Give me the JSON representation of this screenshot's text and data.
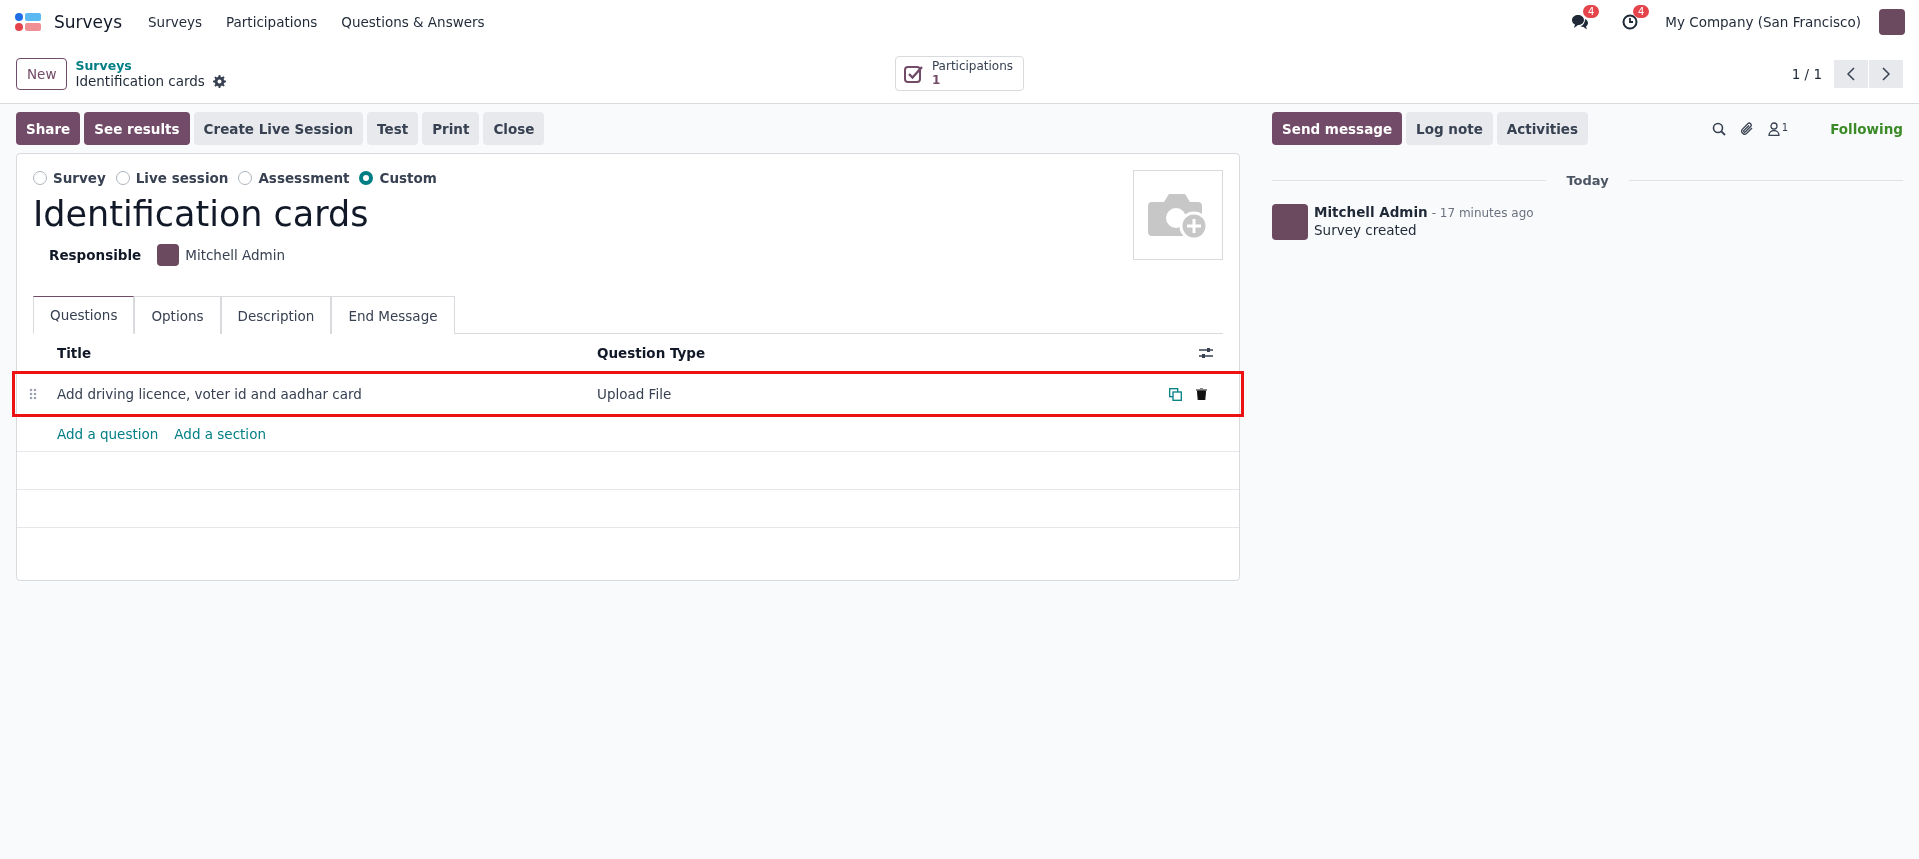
{
  "navbar": {
    "app_name": "Surveys",
    "menu": [
      "Surveys",
      "Participations",
      "Questions & Answers"
    ],
    "messages_count": "4",
    "activities_count": "4",
    "company": "My Company (San Francisco)"
  },
  "control_panel": {
    "new_button": "New",
    "breadcrumb": "Surveys",
    "record_name": "Identification cards",
    "smart_button": {
      "label": "Participations",
      "value": "1"
    },
    "pager": "1 / 1"
  },
  "actions": [
    {
      "label": "Share",
      "primary": true
    },
    {
      "label": "See results",
      "primary": true
    },
    {
      "label": "Create Live Session",
      "primary": false
    },
    {
      "label": "Test",
      "primary": false
    },
    {
      "label": "Print",
      "primary": false
    },
    {
      "label": "Close",
      "primary": false
    }
  ],
  "form": {
    "survey_types": [
      {
        "label": "Survey",
        "selected": false
      },
      {
        "label": "Live session",
        "selected": false
      },
      {
        "label": "Assessment",
        "selected": false
      },
      {
        "label": "Custom",
        "selected": true
      }
    ],
    "title": "Identification cards",
    "responsible_label": "Responsible",
    "responsible": "Mitchell Admin",
    "tabs": [
      {
        "label": "Questions",
        "selected": true
      },
      {
        "label": "Options",
        "selected": false
      },
      {
        "label": "Description",
        "selected": false
      },
      {
        "label": "End Message",
        "selected": false
      }
    ],
    "table": {
      "columns": [
        "Title",
        "Question Type"
      ],
      "rows": [
        {
          "title": "Add driving licence, voter id and aadhar card",
          "type": "Upload File",
          "highlighted": true
        }
      ],
      "add_links": [
        "Add a question",
        "Add a section"
      ]
    }
  },
  "chatter": {
    "buttons": [
      {
        "label": "Send message",
        "primary": true
      },
      {
        "label": "Log note",
        "primary": false
      },
      {
        "label": "Activities",
        "primary": false
      }
    ],
    "followers_count": "1",
    "following": "Following",
    "date_separator": "Today",
    "messages": [
      {
        "author": "Mitchell Admin",
        "time": "- 17 minutes ago",
        "body": "Survey created"
      }
    ]
  }
}
